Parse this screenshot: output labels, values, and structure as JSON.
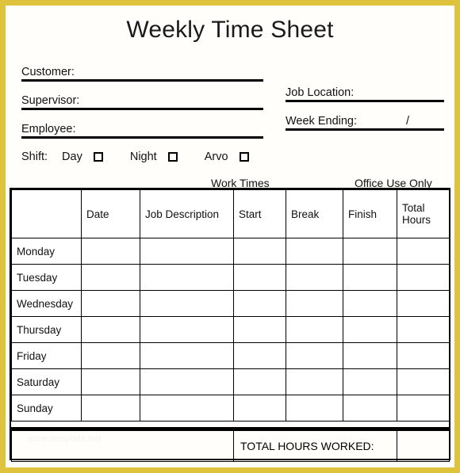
{
  "document": {
    "title": "Weekly Time Sheet",
    "frame_color": "#e0c33c",
    "paper_color": "#fffefb"
  },
  "header_fields": {
    "left": [
      {
        "label": "Customer:",
        "value": ""
      },
      {
        "label": "Supervisor:",
        "value": ""
      },
      {
        "label": "Employee:",
        "value": ""
      }
    ],
    "right": [
      {
        "label": "Job Location:",
        "value": ""
      },
      {
        "label": "Week Ending:",
        "value": "",
        "separator": "/"
      }
    ]
  },
  "shift": {
    "label": "Shift:",
    "options": [
      {
        "name": "Day",
        "checked": false
      },
      {
        "name": "Night",
        "checked": false
      },
      {
        "name": "Arvo",
        "checked": false
      }
    ]
  },
  "section_captions": {
    "work_times": "Work Times",
    "office_use_only": "Office Use Only"
  },
  "table": {
    "columns": [
      "",
      "Date",
      "Job Description",
      "Start",
      "Break",
      "Finish",
      "Total Hours"
    ],
    "rows": [
      {
        "day": "Monday",
        "date": "",
        "job_description": "",
        "start": "",
        "break": "",
        "finish": "",
        "total_hours": ""
      },
      {
        "day": "Tuesday",
        "date": "",
        "job_description": "",
        "start": "",
        "break": "",
        "finish": "",
        "total_hours": ""
      },
      {
        "day": "Wednesday",
        "date": "",
        "job_description": "",
        "start": "",
        "break": "",
        "finish": "",
        "total_hours": ""
      },
      {
        "day": "Thursday",
        "date": "",
        "job_description": "",
        "start": "",
        "break": "",
        "finish": "",
        "total_hours": ""
      },
      {
        "day": "Friday",
        "date": "",
        "job_description": "",
        "start": "",
        "break": "",
        "finish": "",
        "total_hours": ""
      },
      {
        "day": "Saturday",
        "date": "",
        "job_description": "",
        "start": "",
        "break": "",
        "finish": "",
        "total_hours": ""
      },
      {
        "day": "Sunday",
        "date": "",
        "job_description": "",
        "start": "",
        "break": "",
        "finish": "",
        "total_hours": ""
      }
    ],
    "total_row": {
      "label": "TOTAL HOURS WORKED:",
      "value": ""
    }
  },
  "watermark": {
    "text": "www.template.net"
  }
}
